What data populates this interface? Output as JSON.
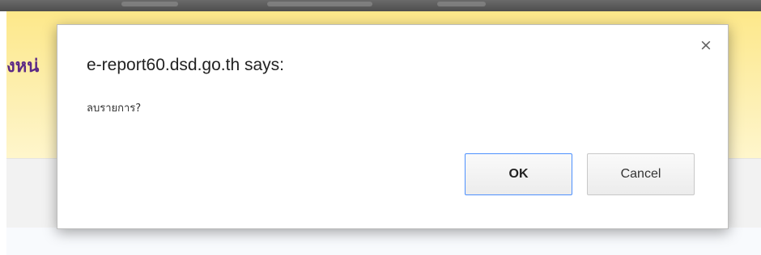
{
  "dialog": {
    "title": "e-report60.dsd.go.th says:",
    "message": "ลบรายการ?",
    "ok_label": "OK",
    "cancel_label": "Cancel",
    "close_symbol": "×"
  },
  "background": {
    "heading_fragment": "งหน่"
  },
  "colors": {
    "top_bar": "#555555",
    "yellow_band": "#fdf1b9",
    "heading_text": "#5b2a86",
    "ok_border": "#4d90fe"
  },
  "icons": {
    "close": "close-icon"
  }
}
